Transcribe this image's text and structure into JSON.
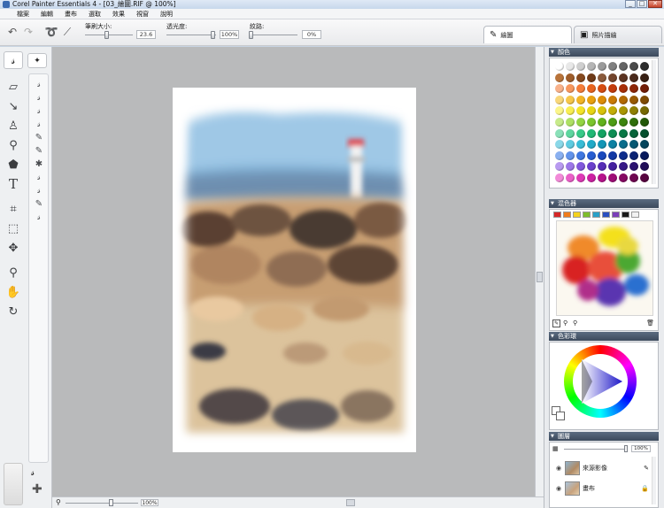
{
  "window": {
    "title": "Corel Painter Essentials 4 - [03_繪圖.RIF @ 100%]",
    "buttons": [
      "_",
      "□",
      "✕"
    ]
  },
  "menubar": [
    "檔案",
    "編輯",
    "畫布",
    "選取",
    "效果",
    "視窗",
    "說明"
  ],
  "property_bar": {
    "brush_size_label": "筆刷大小:",
    "brush_size_value": "23.6",
    "opacity_label": "透光度:",
    "opacity_value": "100%",
    "grain_label": "紋路:",
    "grain_value": "0%"
  },
  "mode_tabs": [
    {
      "label": "繪圖",
      "active": true
    },
    {
      "label": "照片描繪",
      "active": false
    }
  ],
  "panels": {
    "colors_title": "顏色",
    "mixer_title": "混色器",
    "color_wheel_title": "色彩環",
    "layers_title": "圖層",
    "layers_opacity": "100%",
    "layers": [
      {
        "name": "來源影像"
      },
      {
        "name": "畫布"
      }
    ]
  },
  "status": {
    "zoom": "100%"
  },
  "swatch_colors": [
    [
      "#ffffff",
      "#e8e8e8",
      "#cfcfcf",
      "#b5b5b5",
      "#9a9a9a",
      "#7f7f7f",
      "#646464",
      "#4a4a4a",
      "#2d2d2d"
    ],
    [
      "#b8733a",
      "#9e5c2a",
      "#86491f",
      "#6f3a18",
      "#8a5a3c",
      "#73452d",
      "#5c3422",
      "#4a2a1b",
      "#382014"
    ],
    [
      "#f8b18a",
      "#f7975e",
      "#f57d3a",
      "#e8641f",
      "#d64d12",
      "#c23b0b",
      "#a82f08",
      "#8d2607",
      "#721d06"
    ],
    [
      "#f8d77a",
      "#f6c74a",
      "#f2b526",
      "#e9a10f",
      "#dd8d07",
      "#c97a05",
      "#b26a04",
      "#985a04",
      "#7f4b03"
    ],
    [
      "#fbf58a",
      "#f8ee52",
      "#f3e42a",
      "#e7d514",
      "#d7c20b",
      "#c2ad07",
      "#a99605",
      "#8f7f04",
      "#766903"
    ],
    [
      "#c7ea8a",
      "#aee064",
      "#94d443",
      "#7bc52c",
      "#62b21c",
      "#4d9c14",
      "#3d850f",
      "#2f6e0b",
      "#225808"
    ],
    [
      "#8ae0b8",
      "#5ed69e",
      "#37c987",
      "#1fb874",
      "#12a362",
      "#0c8e53",
      "#087845",
      "#066339",
      "#044f2d"
    ],
    [
      "#8ad8e8",
      "#5ecbe0",
      "#38bcd6",
      "#1faac8",
      "#1296b6",
      "#0c81a2",
      "#086c8b",
      "#065873",
      "#04455c"
    ],
    [
      "#8ab0f0",
      "#6293ea",
      "#3f77e0",
      "#265dd2",
      "#1848bd",
      "#1138a5",
      "#0d2c8c",
      "#0a2273",
      "#07195c"
    ],
    [
      "#b89af0",
      "#9c77e8",
      "#8158dc",
      "#6a3fcc",
      "#562cb6",
      "#45209f",
      "#371887",
      "#2b126f",
      "#200d58"
    ],
    [
      "#f28ad8",
      "#ea5fc8",
      "#de39b6",
      "#cc20a2",
      "#b6128c",
      "#9e0c77",
      "#860963",
      "#6f0751",
      "#580540"
    ]
  ],
  "mixer_colors": [
    "#d62828",
    "#f07c1c",
    "#f4d21e",
    "#7dbd2c",
    "#2aa0c8",
    "#2a4fc0",
    "#7b3fb8",
    "#1a1a1a",
    "#f2f2f2"
  ]
}
